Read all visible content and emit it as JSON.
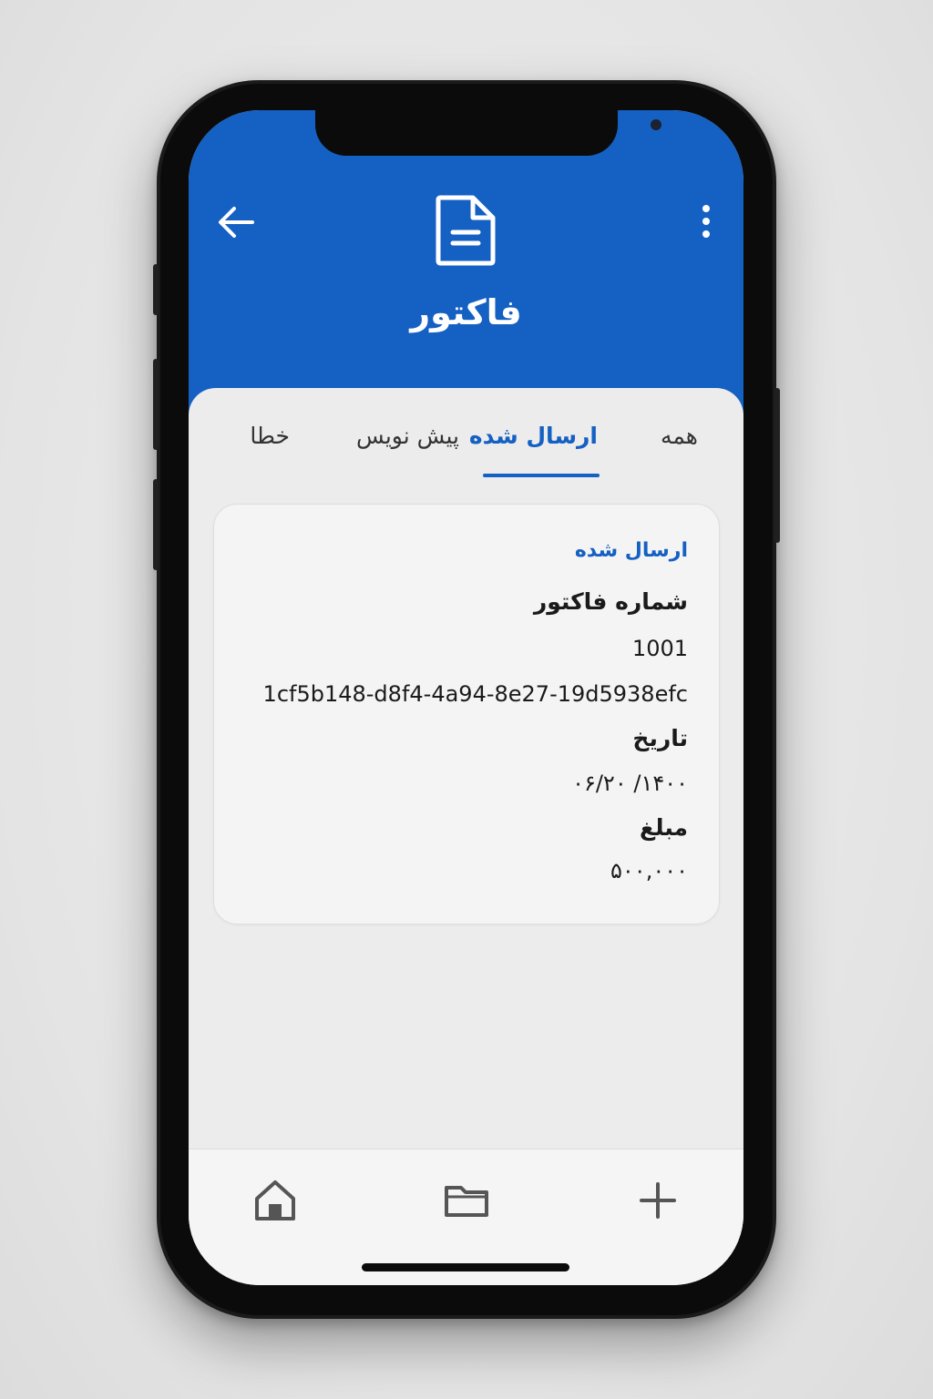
{
  "header": {
    "title": "فاکتور",
    "back_icon": "arrow-left-icon",
    "menu_icon": "more-vertical-icon",
    "doc_icon": "document-icon",
    "color": "#1460c3"
  },
  "tabs": [
    {
      "label": "همه",
      "active": false
    },
    {
      "label": "ارسال شده",
      "active": true
    },
    {
      "label": "پیش نویس",
      "active": false
    },
    {
      "label": "خطا",
      "active": false
    }
  ],
  "invoice": {
    "status": "ارسال شده",
    "number_label": "شماره فاکتور",
    "number": "1001",
    "uuid": "1cf5b148-d8f4-4a94-8e27-19d5938efc",
    "date_label": "تاریخ",
    "date": "۱۴۰۰/ ۰۶/۲۰",
    "amount_label": "مبلغ",
    "amount": "۵۰۰,۰۰۰"
  },
  "bottom_nav": [
    {
      "icon": "home-icon"
    },
    {
      "icon": "folder-icon"
    },
    {
      "icon": "plus-icon"
    }
  ]
}
